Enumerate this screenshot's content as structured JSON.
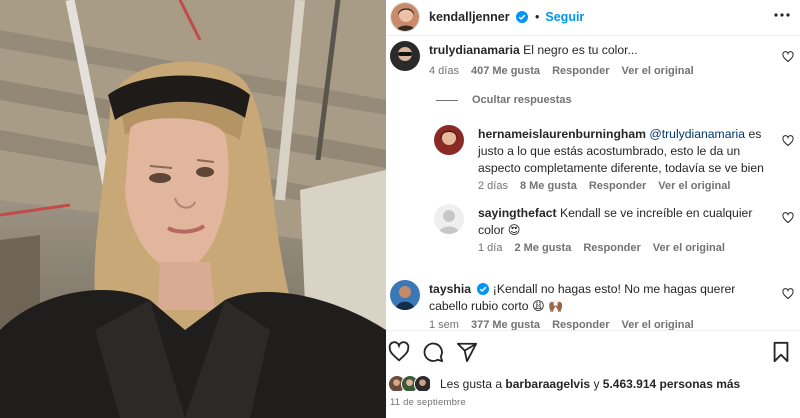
{
  "header": {
    "username": "kendalljenner",
    "separator": "•",
    "follow_label": "Seguir"
  },
  "comments": [
    {
      "username": "trulydianamaria",
      "text": "El negro es tu color...",
      "time": "4 días",
      "likes": "407 Me gusta",
      "reply_label": "Responder",
      "original_label": "Ver el original"
    }
  ],
  "hide_replies_label": "Ocultar respuestas",
  "replies": [
    {
      "username": "hernameislaurenburningham",
      "mention": "@trulydianamaria",
      "text": "es justo a lo que estás acostumbrado, esto le da un aspecto completamente diferente, todavía se ve bien",
      "time": "2 días",
      "likes": "8 Me gusta",
      "reply_label": "Responder",
      "original_label": "Ver el original"
    },
    {
      "username": "sayingthefact",
      "text": "Kendall se ve increíble en cualquier color 😍",
      "time": "1 día",
      "likes": "2 Me gusta",
      "reply_label": "Responder",
      "original_label": "Ver el original"
    }
  ],
  "comment_last": {
    "username": "tayshia",
    "text": "¡Kendall no hagas esto! No me hagas querer cabello rubio corto 😩 🙌🏾",
    "time": "1 sem",
    "likes": "377 Me gusta",
    "reply_label": "Responder",
    "original_label": "Ver el original"
  },
  "likes_line": {
    "prefix": "Les gusta a",
    "user": "barbaraagelvis",
    "connector": "y",
    "count": "5.463.914 personas más"
  },
  "date": "11 de septiembre",
  "colors": {
    "accent": "#0095f6",
    "verified": "#0095f6",
    "muted": "#737373"
  },
  "icons": [
    "more-icon",
    "heart-icon",
    "comment-icon",
    "share-icon",
    "bookmark-icon",
    "verified-icon"
  ]
}
